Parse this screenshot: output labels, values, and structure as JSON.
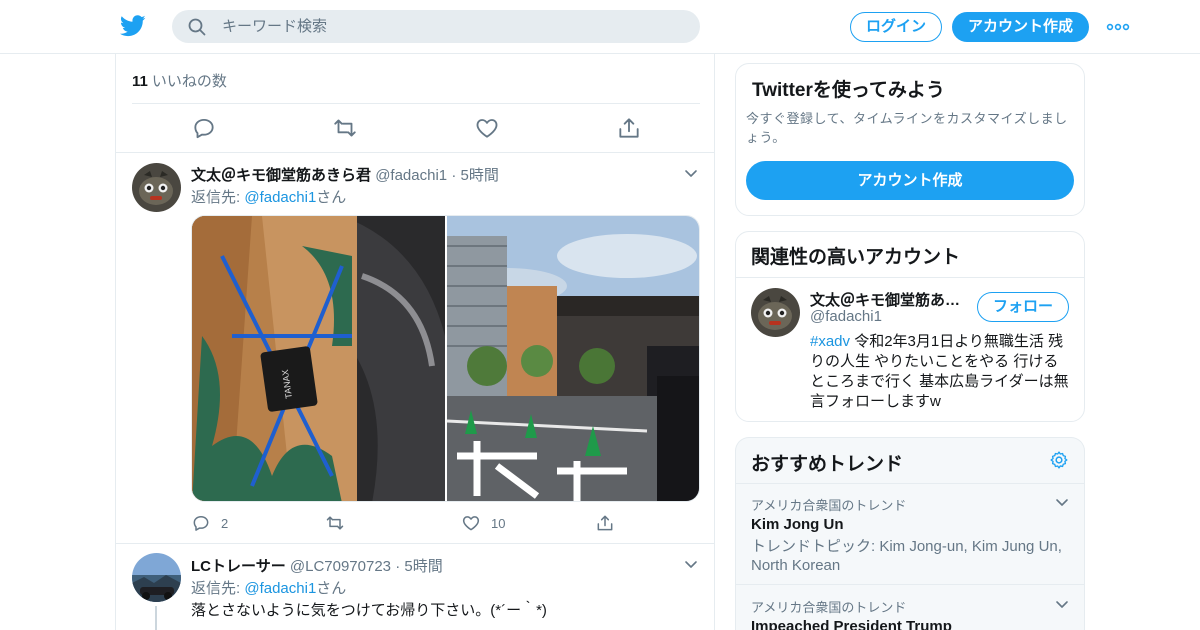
{
  "header": {
    "search_placeholder": "キーワード検索",
    "login_label": "ログイン",
    "signup_label": "アカウント作成"
  },
  "main": {
    "likes_count": "11",
    "likes_label": "いいねの数",
    "tweets": [
      {
        "name": "文太＠キモ御堂筋あきら君",
        "handle": "@fadachi1",
        "separator": "·",
        "time": "5時間",
        "reply_prefix": "返信先: ",
        "reply_mention": "@fadachi1",
        "reply_suffix": "さん",
        "reply_count": "2",
        "retweet_count": "",
        "like_count": "10"
      },
      {
        "name": "LCトレーサー",
        "handle": "@LC70970723",
        "separator": "·",
        "time": "5時間",
        "reply_prefix": "返信先: ",
        "reply_mention": "@fadachi1",
        "reply_suffix": "さん",
        "text": "落とさないように気をつけてお帰り下さい。(*´ー｀*)"
      }
    ]
  },
  "sidebar": {
    "signup_card": {
      "title": "Twitterを使ってみよう",
      "description": "今すぐ登録して、タイムラインをカスタマイズしましょう。",
      "button": "アカウント作成"
    },
    "related": {
      "title": "関連性の高いアカウント",
      "account_name": "文太＠キモ御堂筋あきら君",
      "account_handle": "@fadachi1",
      "follow_label": "フォロー",
      "bio_hashtag": "#xadv",
      "bio_text": " 令和2年3月1日より無職生活 残りの人生 やりたいことをやる 行けるところまで行く 基本広島ライダーは無言フォローしますw"
    },
    "trends": {
      "title": "おすすめトレンド",
      "items": [
        {
          "context": "アメリカ合衆国のトレンド",
          "name": "Kim Jong Un",
          "related": "トレンドトピック: Kim Jong-un, Kim Jung Un, North Korean"
        },
        {
          "context": "アメリカ合衆国のトレンド",
          "name": "Impeached President Trump"
        }
      ]
    }
  },
  "colors": {
    "accent": "#1da1f2",
    "link": "#1b95e0",
    "muted": "#657786",
    "border": "#e6ecf0"
  }
}
